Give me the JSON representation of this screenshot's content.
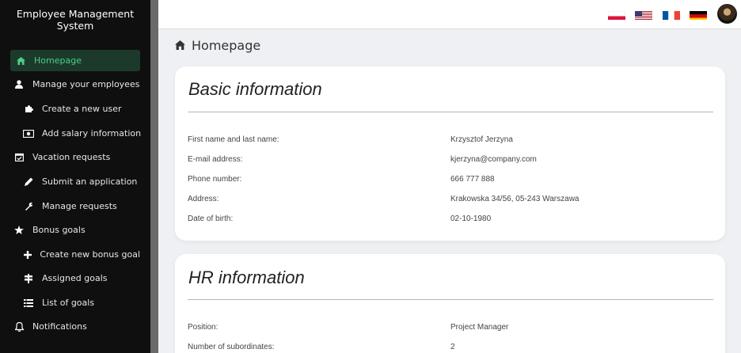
{
  "sidebar": {
    "title_line1": "Employee Management",
    "title_line2": "System",
    "items": [
      {
        "label": "Homepage",
        "icon": "home-icon"
      },
      {
        "label": "Manage your employees",
        "icon": "user-icon"
      },
      {
        "label": "Create a new user",
        "icon": "puzzle-icon"
      },
      {
        "label": "Add salary information",
        "icon": "money-icon"
      },
      {
        "label": "Vacation requests",
        "icon": "calendar-check-icon"
      },
      {
        "label": "Submit an application",
        "icon": "pencil-icon"
      },
      {
        "label": "Manage requests",
        "icon": "wrench-icon"
      },
      {
        "label": "Bonus goals",
        "icon": "star-icon"
      },
      {
        "label": "Create new bonus goal",
        "icon": "plus-icon"
      },
      {
        "label": "Assigned goals",
        "icon": "signpost-icon"
      },
      {
        "label": "List of goals",
        "icon": "list-icon"
      },
      {
        "label": "Notifications",
        "icon": "bell-icon"
      }
    ]
  },
  "topbar": {
    "languages": [
      "Polish",
      "English",
      "French",
      "German"
    ]
  },
  "page": {
    "title": "Homepage"
  },
  "basic": {
    "title": "Basic information",
    "rows": [
      {
        "label": "First name and last name:",
        "value": "Krzysztof Jerzyna"
      },
      {
        "label": "E-mail address:",
        "value": "kjerzyna@company.com"
      },
      {
        "label": "Phone number:",
        "value": "666 777 888"
      },
      {
        "label": "Address:",
        "value": "Krakowska 34/56, 05-243 Warszawa"
      },
      {
        "label": "Date of birth:",
        "value": "02-10-1980"
      }
    ]
  },
  "hr": {
    "title": "HR information",
    "rows": [
      {
        "label": "Position:",
        "value": "Project Manager"
      },
      {
        "label": "Number of subordinates:",
        "value": "2"
      }
    ]
  },
  "colors": {
    "sidebar_bg": "#0f0f0f",
    "active_bg": "#1c3a2b",
    "active_text": "#4ccc8a",
    "page_bg": "#eef0f3"
  }
}
